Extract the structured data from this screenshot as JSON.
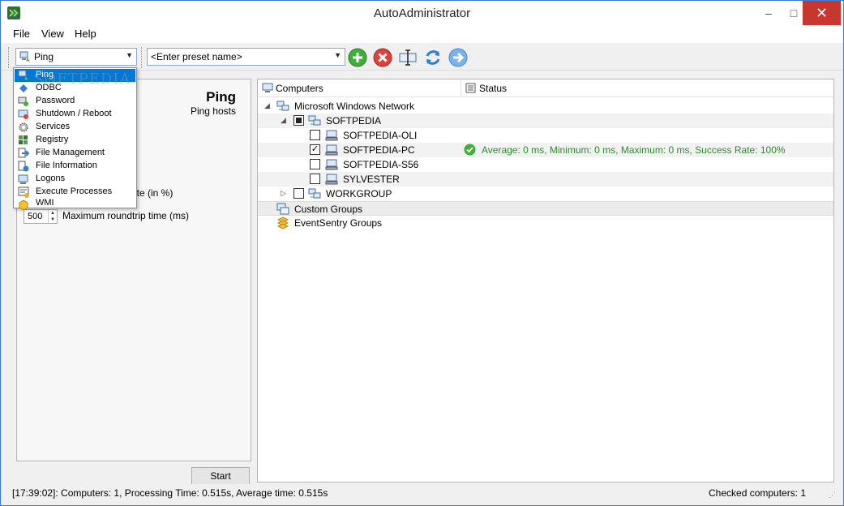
{
  "window": {
    "title": "AutoAdministrator"
  },
  "menu": [
    "File",
    "View",
    "Help"
  ],
  "toolbar": {
    "module_selected": "Ping",
    "preset_placeholder": "<Enter preset name>"
  },
  "dropdown": {
    "items": [
      "Ping",
      "ODBC",
      "Password",
      "Shutdown / Reboot",
      "Services",
      "Registry",
      "File Management",
      "File Information",
      "Logons",
      "Execute Processes",
      "WMI"
    ],
    "selected_index": 0
  },
  "left_panel": {
    "title": "Ping",
    "subtitle": "Ping hosts",
    "field1_label_partial": "ate (in %)",
    "field2_value": "500",
    "field2_label": "Maximum roundtrip time (ms)",
    "start_label": "Start"
  },
  "tree": {
    "col_computers": "Computers",
    "col_status": "Status",
    "network": "Microsoft Windows Network",
    "domain": "SOFTPEDIA",
    "hosts": [
      {
        "name": "SOFTPEDIA-OLI",
        "checked": false,
        "status": ""
      },
      {
        "name": "SOFTPEDIA-PC",
        "checked": true,
        "status": "Average: 0 ms, Minimum: 0 ms, Maximum: 0 ms, Success Rate: 100%"
      },
      {
        "name": "SOFTPEDIA-S56",
        "checked": false,
        "status": ""
      },
      {
        "name": "SYLVESTER",
        "checked": false,
        "status": ""
      }
    ],
    "workgroup": "WORKGROUP",
    "custom_groups": "Custom Groups",
    "eventsentry_groups": "EventSentry Groups"
  },
  "statusbar": {
    "left": "[17:39:02]: Computers: 1, Processing Time: 0.515s, Average time: 0.515s",
    "right": "Checked computers: 1"
  },
  "watermark": "SOFTPEDIA",
  "colors": {
    "accent": "#0078d7",
    "success": "#2e8b2e",
    "close": "#c7372f"
  }
}
